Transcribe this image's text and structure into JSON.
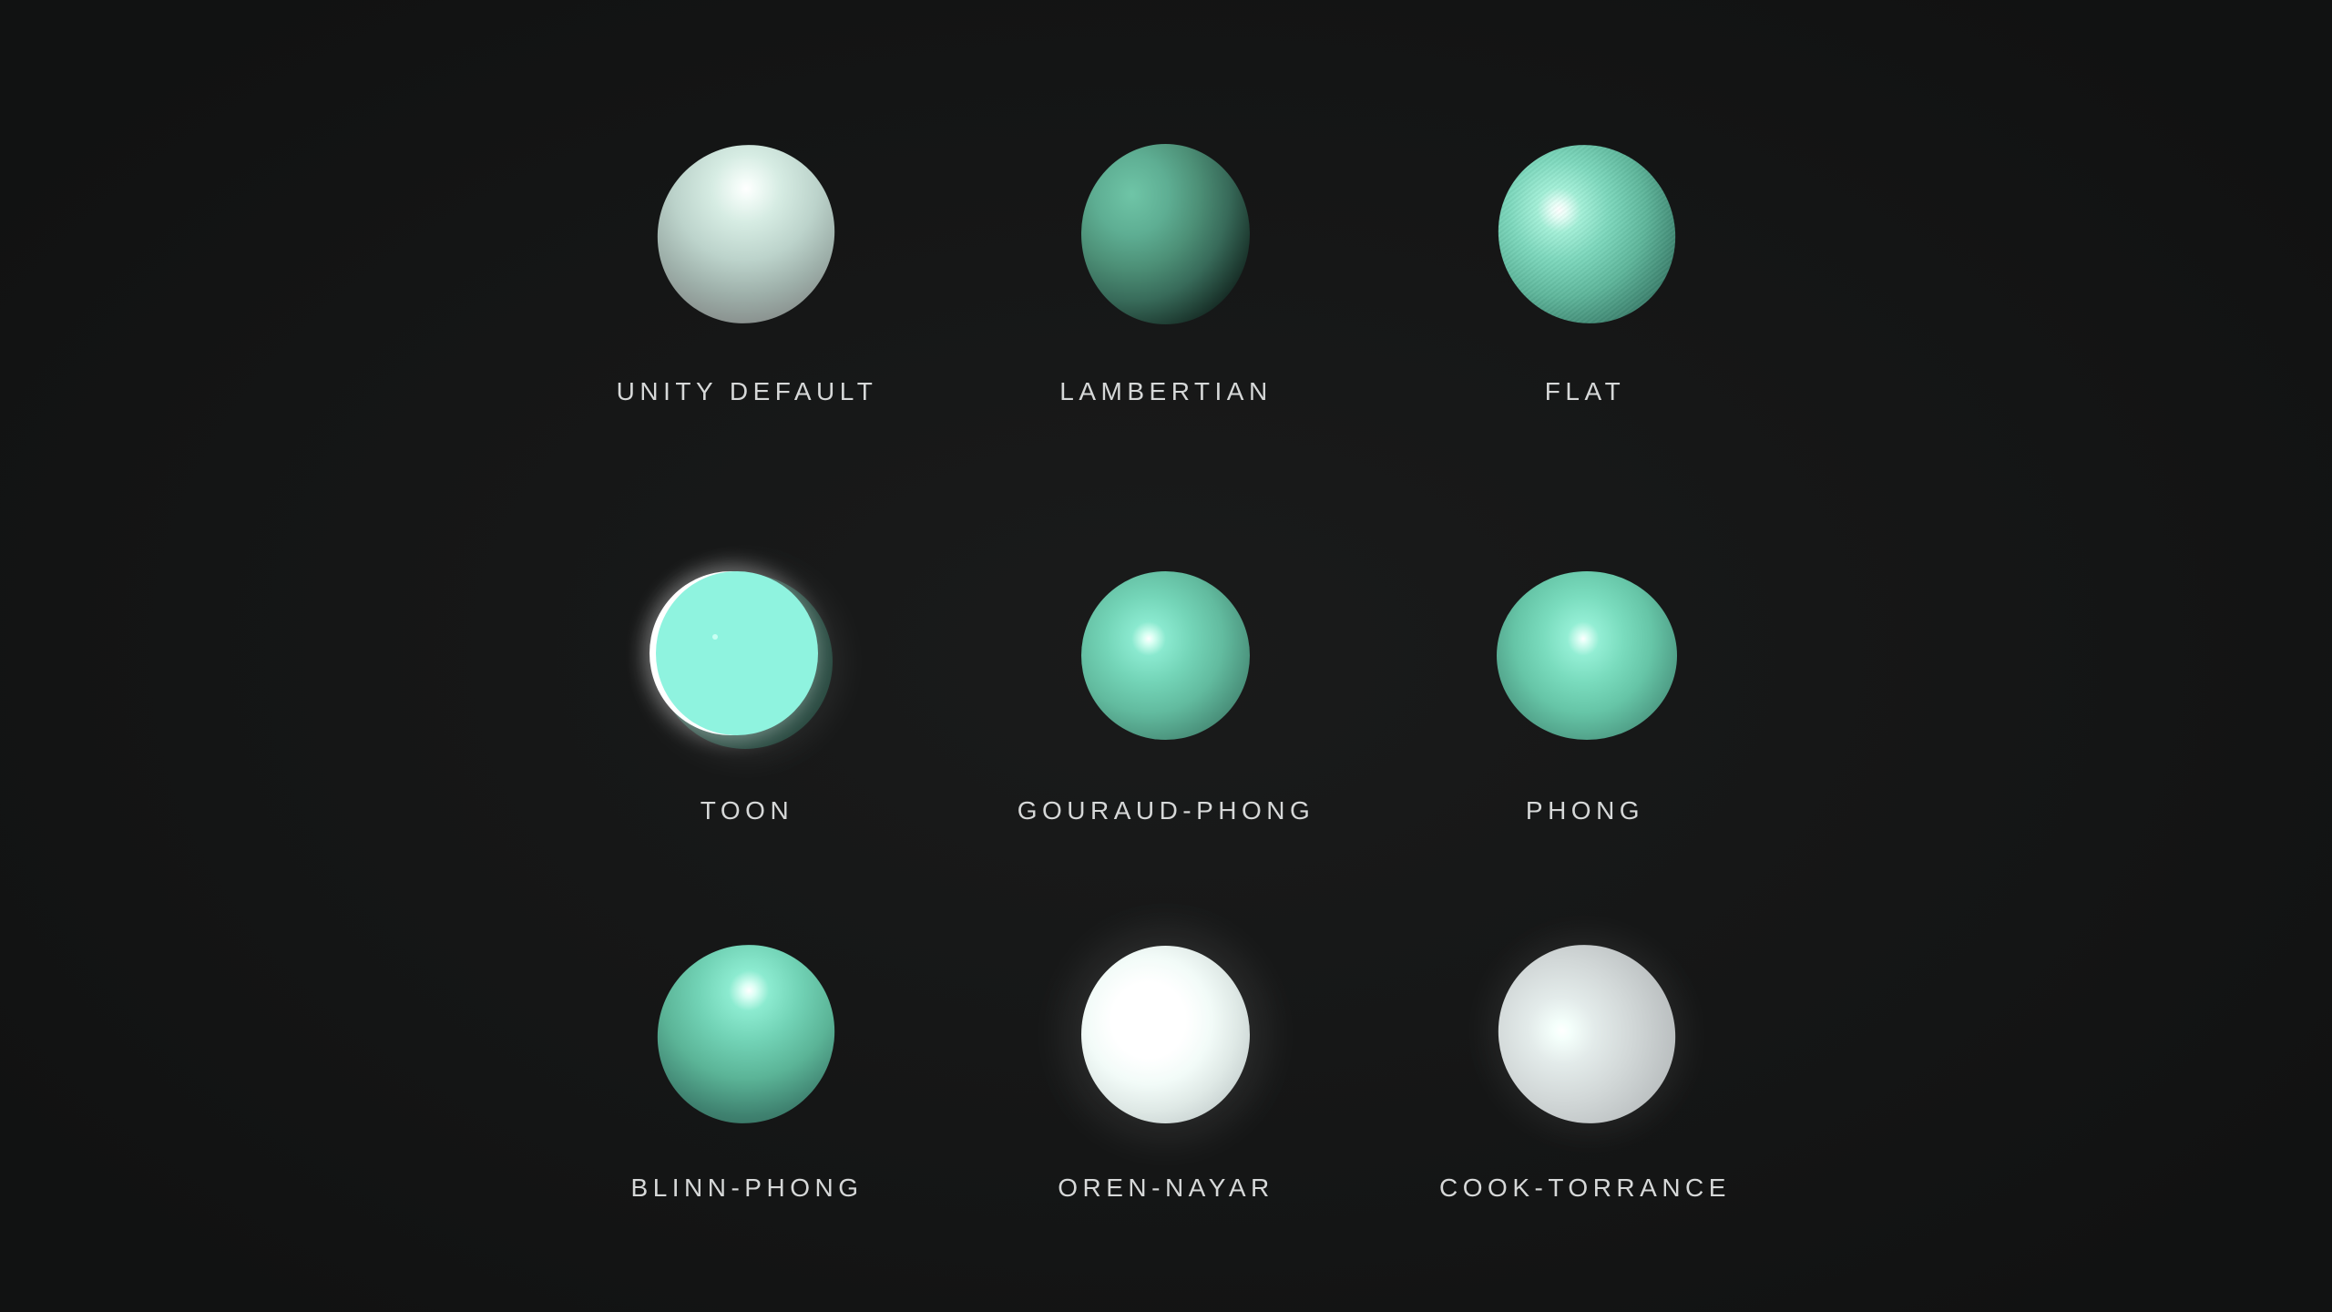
{
  "shaders": [
    {
      "name": "UNITY DEFAULT",
      "icon": "sphere-render"
    },
    {
      "name": "LAMBERTIAN",
      "icon": "sphere-render"
    },
    {
      "name": "FLAT",
      "icon": "sphere-render"
    },
    {
      "name": "TOON",
      "icon": "sphere-render"
    },
    {
      "name": "GOURAUD-PHONG",
      "icon": "sphere-render"
    },
    {
      "name": "PHONG",
      "icon": "sphere-render"
    },
    {
      "name": "BLINN-PHONG",
      "icon": "sphere-render"
    },
    {
      "name": "OREN-NAYAR",
      "icon": "sphere-render"
    },
    {
      "name": "COOK-TORRANCE",
      "icon": "sphere-render"
    }
  ],
  "colors": {
    "background": "#141515",
    "label": "#d6d8d8",
    "base_teal": "#7adcbe"
  }
}
